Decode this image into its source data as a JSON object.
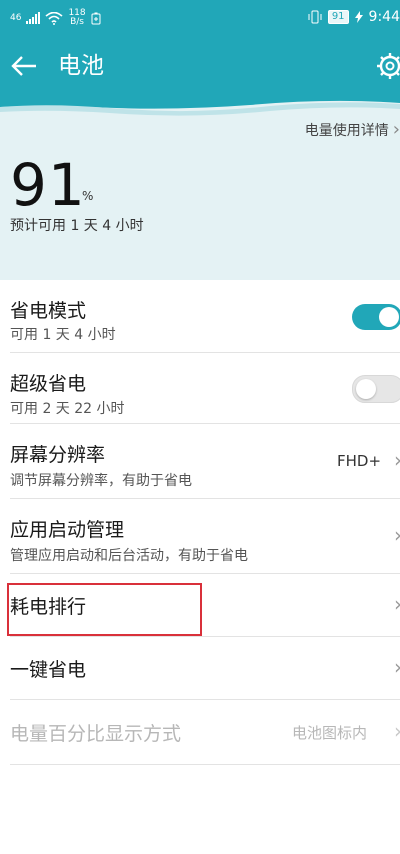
{
  "status_bar": {
    "signal": "46",
    "net_speed_value": "118",
    "net_speed_unit": "B/s",
    "battery": "91",
    "time": "9:44"
  },
  "header": {
    "title": "电池"
  },
  "hero": {
    "usage_link": "电量使用详情",
    "percent": "91",
    "percent_unit": "%",
    "estimate": "预计可用 1 天 4 小时"
  },
  "settings": {
    "power_saving": {
      "title": "省电模式",
      "subtitle": "可用 1 天 4 小时",
      "enabled": true
    },
    "ultra_power_saving": {
      "title": "超级省电",
      "subtitle": "可用 2 天 22 小时",
      "enabled": false
    },
    "resolution": {
      "title": "屏幕分辨率",
      "subtitle": "调节屏幕分辨率，有助于省电",
      "value": "FHD+"
    },
    "app_launch": {
      "title": "应用启动管理",
      "subtitle": "管理应用启动和后台活动，有助于省电"
    },
    "consumption_rank": {
      "title": "耗电排行"
    },
    "one_key_save": {
      "title": "一键省电"
    },
    "percent_display": {
      "title": "电量百分比显示方式",
      "value": "电池图标内"
    }
  },
  "colors": {
    "accent": "#21a7b8",
    "highlight": "#d9303a"
  }
}
